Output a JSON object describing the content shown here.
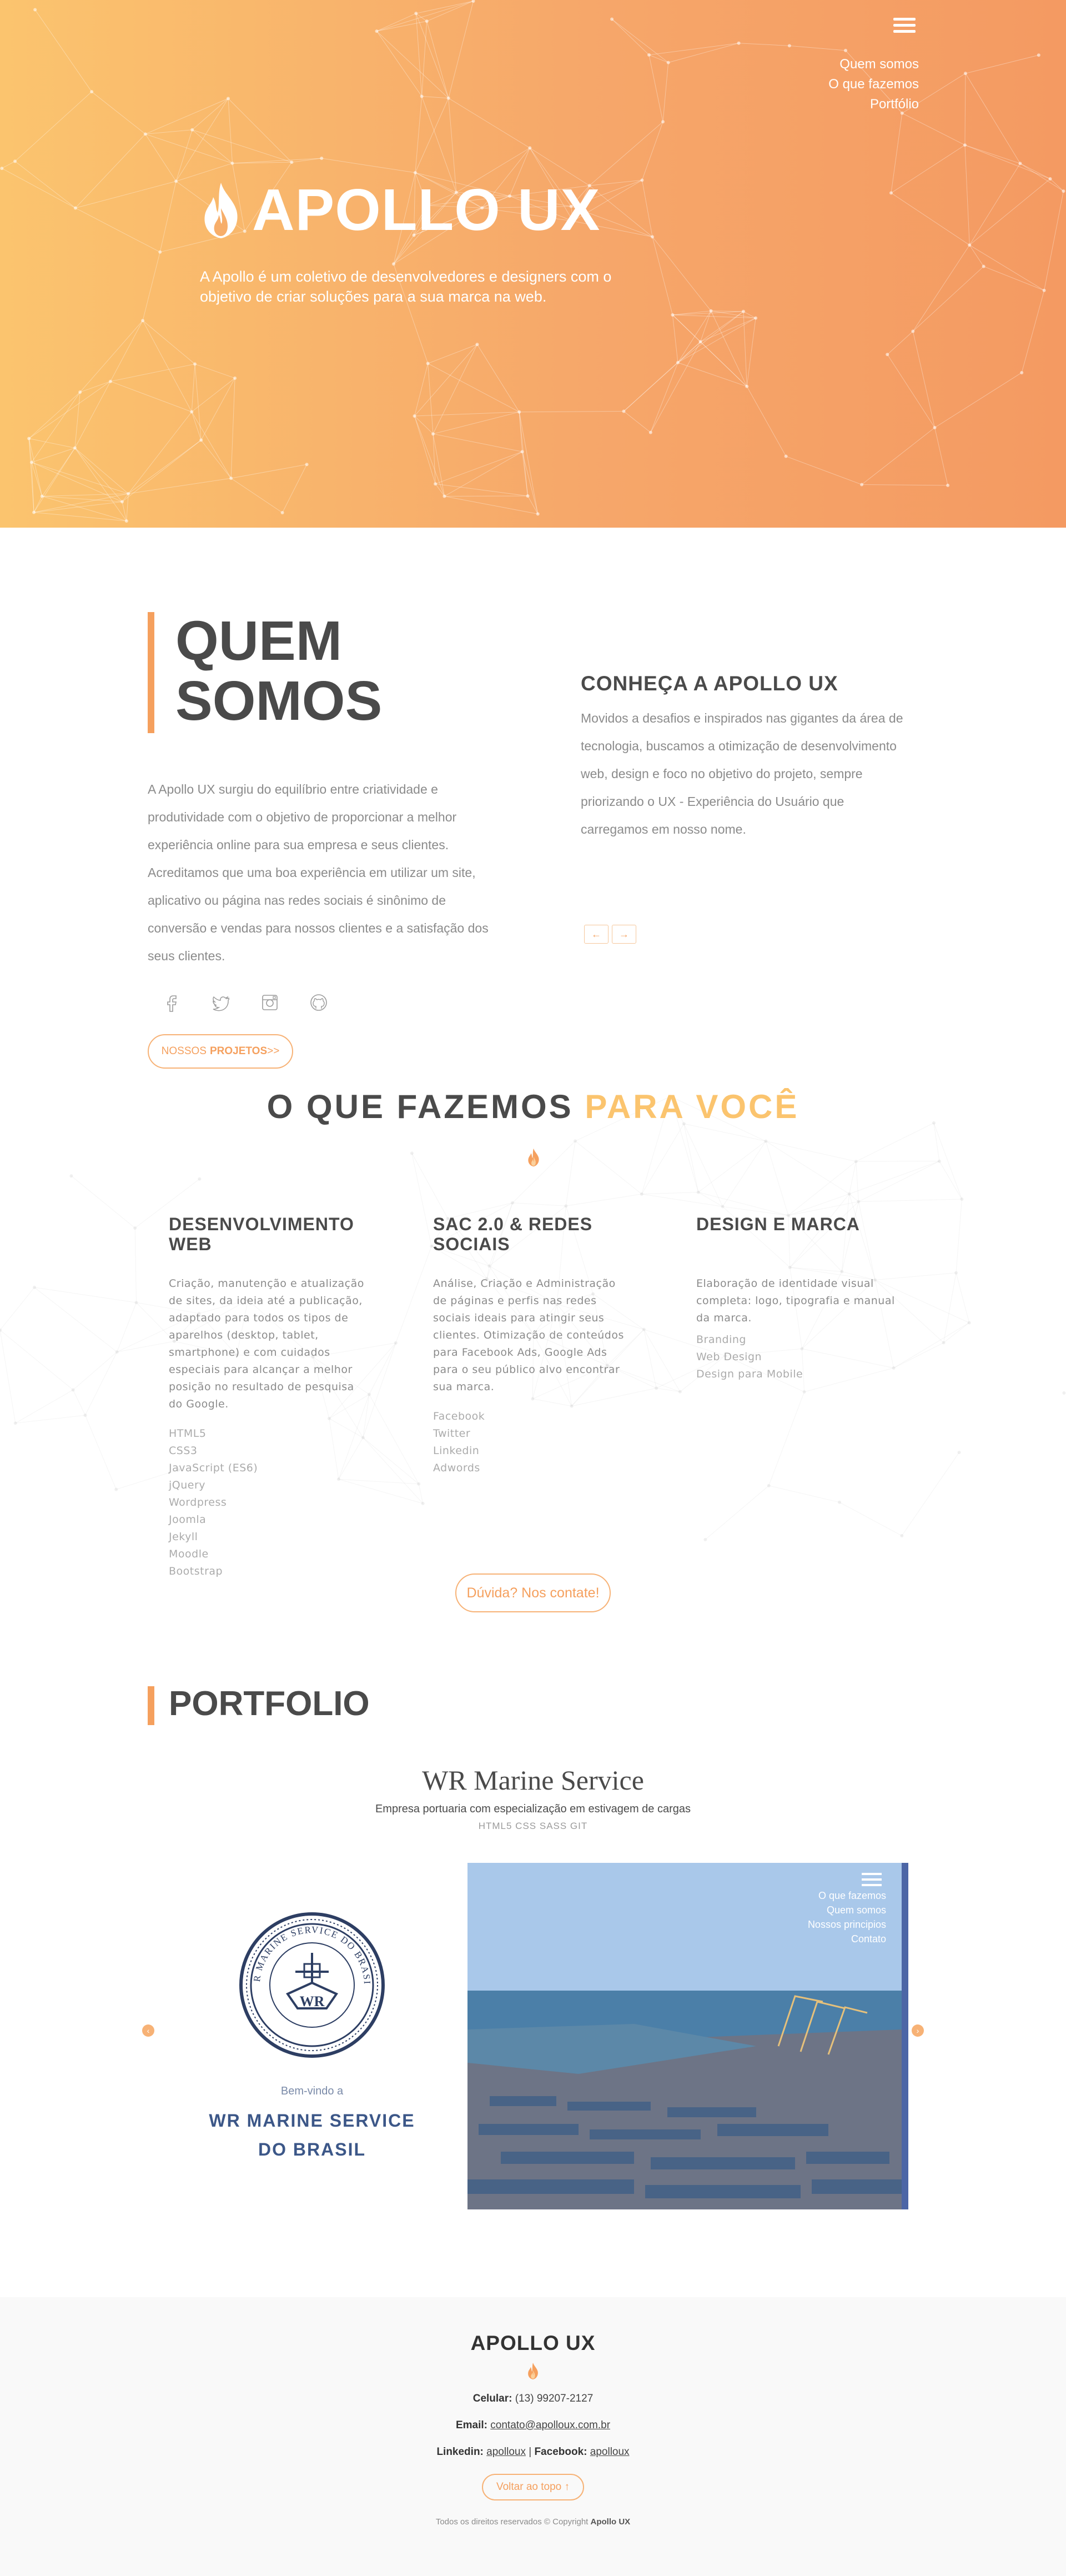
{
  "nav": {
    "menu_icon": "hamburger-icon",
    "items": [
      "Quem somos",
      "O que fazemos",
      "Portfólio"
    ]
  },
  "hero": {
    "logo_icon": "flame-icon",
    "title": "APOLLO UX",
    "description": "A Apollo é um coletivo de desenvolvedores e designers com o objetivo de criar soluções para a sua marca na web."
  },
  "about": {
    "title_line1": "QUEM",
    "title_line2": "SOMOS",
    "text": "A Apollo UX surgiu do equilíbrio entre criatividade e produtividade com o objetivo de proporcionar a melhor experiência online para sua empresa e seus clientes. Acreditamos que uma boa experiência em utilizar um site, aplicativo ou página nas redes sociais é sinônimo de conversão e vendas para nossos clientes e a satisfação dos seus clientes.",
    "social_icons": [
      "facebook-icon",
      "twitter-icon",
      "instagram-icon",
      "github-icon"
    ],
    "projects_button_prefix": "NOSSOS",
    "projects_button_strong": "PROJETOS",
    "projects_button_suffix": ">>",
    "know_title": "CONHEÇA A APOLLO UX",
    "know_text": "Movidos a desafios e inspirados nas gigantes da área de tecnologia, buscamos a otimização de desenvolvimento web, design e foco no objetivo do projeto, sempre priorizando o UX - Experiência do Usuário que carregamos em nosso nome.",
    "carousel_prev": "←",
    "carousel_next": "→"
  },
  "services": {
    "title_main": "O QUE FAZEMOS",
    "title_accent": "PARA VOCÊ",
    "flame_icon": "flame-icon",
    "columns": [
      {
        "title": "DESENVOLVIMENTO WEB",
        "text": "Criação, manutenção e atualização de sites, da ideia até a publicação, adaptado para todos os tipos de aparelhos (desktop, tablet, smartphone) e com cuidados especiais para alcançar a melhor posição no resultado de pesquisa do Google.",
        "tags_left": [
          "HTML5",
          "CSS3",
          "JavaScript (ES6)",
          "jQuery",
          "Wordpress"
        ],
        "tags_right": [
          "Joomla",
          "Jekyll",
          "Moodle",
          "Bootstrap"
        ]
      },
      {
        "title": "SAC 2.0 & REDES SOCIAIS",
        "text": "Análise, Criação e Administração de páginas e perfis nas redes sociais ideais para atingir seus clientes. Otimização de conteúdos para Facebook Ads, Google Ads para o seu público alvo encontrar sua marca.",
        "tags": [
          "Facebook",
          "Twitter",
          "Linkedin",
          "Adwords"
        ]
      },
      {
        "title": "DESIGN E MARCA",
        "text": "Elaboração de identidade visual completa: logo, tipografia e manual da marca.",
        "tags": [
          "Branding",
          "Web Design",
          "Design para Mobile"
        ]
      }
    ],
    "contact_button": "Dúvida? Nos contate!"
  },
  "portfolio": {
    "title": "PORTFOLIO",
    "project": {
      "name": "WR Marine Service",
      "description": "Empresa portuaria com especialização em estivagem de cargas",
      "tech": "HTML5 CSS SASS GIT"
    },
    "preview": {
      "welcome": "Bem-vindo a",
      "company_line1": "WR MARINE SERVICE",
      "company_line2": "DO BRASIL",
      "seal_text": "WR MARINE SERVICE DO BRASIL",
      "seal_initials": "WR",
      "nav": [
        "O que fazemos",
        "Quem somos",
        "Nossos principios",
        "Contato"
      ]
    },
    "prev_label": "‹",
    "next_label": "›"
  },
  "footer": {
    "title": "APOLLO UX",
    "phone_label": "Celular:",
    "phone": "(13) 99207-2127",
    "email_label": "Email:",
    "email": "contato@apolloux.com.br",
    "linkedin_label": "Linkedin:",
    "linkedin": "apolloux",
    "separator": "|",
    "facebook_label": "Facebook:",
    "facebook": "apolloux",
    "back_to_top": "Voltar ao topo ↑",
    "copyright_text": "Todos os direitos reservados © Copyright",
    "copyright_brand": "Apollo UX"
  },
  "colors": {
    "gradient_start": "#fbc46e",
    "gradient_end": "#f49a62",
    "accent": "#f5a05e",
    "heading": "#4a4a4a",
    "text": "#8b8b8b",
    "portfolio_blue": "#3c5788"
  }
}
